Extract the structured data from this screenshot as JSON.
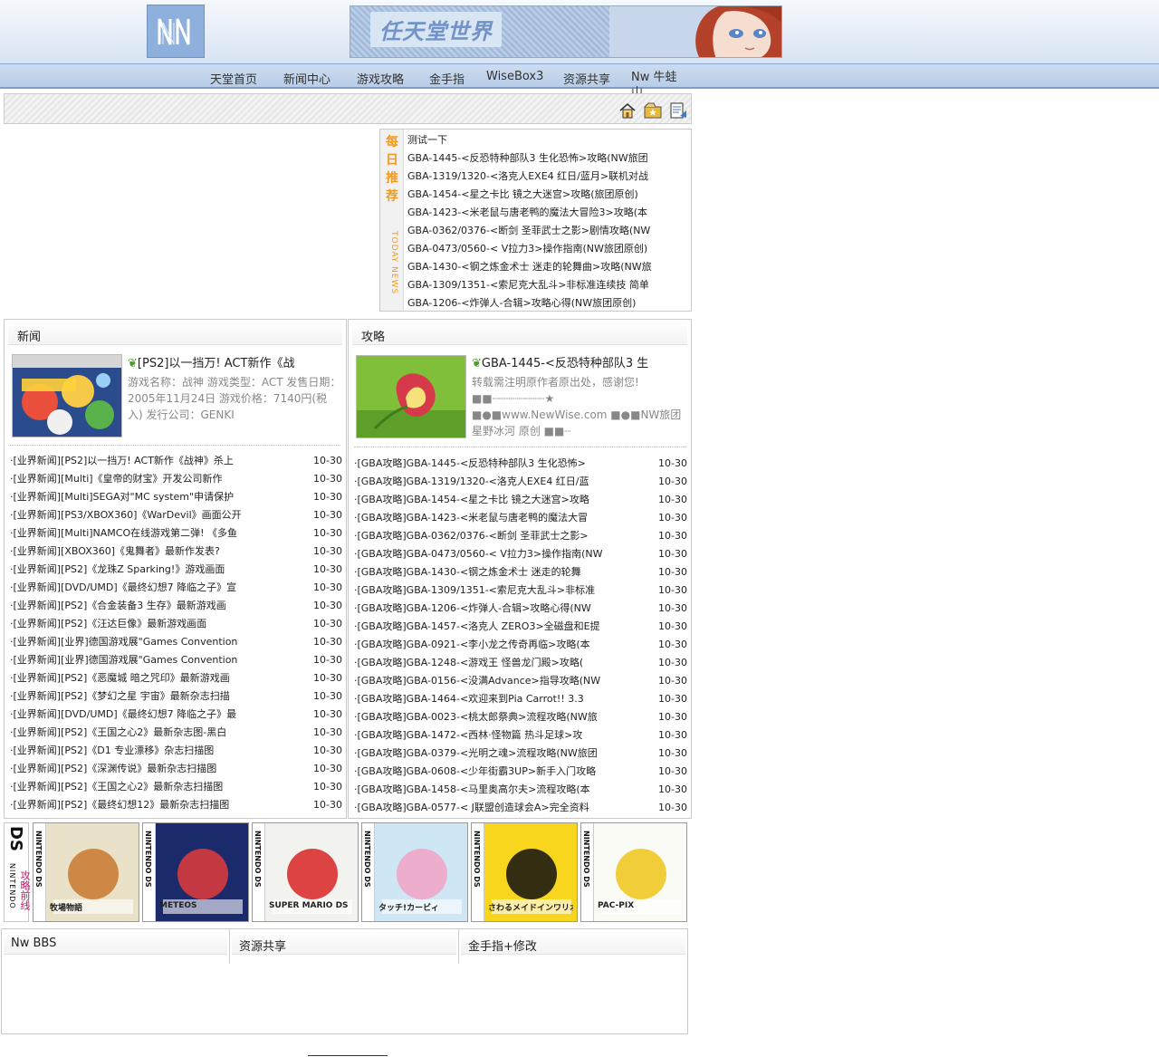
{
  "header": {
    "logo_text": "NN",
    "banner_title": "任天堂世界"
  },
  "nav": {
    "items": [
      "天堂首页",
      "新闻中心",
      "游戏攻略",
      "金手指",
      "WiseBox3",
      "资源共享",
      "Nw 牛蛙山"
    ]
  },
  "toolbar": {
    "icons": [
      "home-icon",
      "favorite-icon",
      "contact-icon"
    ]
  },
  "daily": {
    "title_cn": "每日推荐",
    "title_en": "TODAY NEWS",
    "items": [
      "测试一下",
      "GBA-1445-<反恐特种部队3 生化恐怖>攻略(NW旅团",
      "GBA-1319/1320-<洛克人EXE4 红日/蓝月>联机对战",
      "GBA-1454-<星之卡比 镜之大迷宫>攻略(旅团原创)",
      "GBA-1423-<米老鼠与唐老鸭的魔法大冒险3>攻略(本",
      "GBA-0362/0376-<断剑 圣菲武士之影>剧情攻略(NW",
      "GBA-0473/0560-< V拉力3>操作指南(NW旅团原创)",
      "GBA-1430-<钢之炼金术士 迷走的轮舞曲>攻略(NW旅",
      "GBA-1309/1351-<索尼克大乱斗>非标准连续技 简单",
      "GBA-1206-<炸弹人-合辑>攻略心得(NW旅团原创)"
    ]
  },
  "news": {
    "heading": "新闻",
    "feature": {
      "title": "[PS2]以一挡万! ACT新作《战",
      "body": "游戏名称：战神 游戏类型：ACT 发售日期：2005年11月24日 游戏价格：7140円(税入) 发行公司：GENKI"
    },
    "items": [
      {
        "t": "·[业界新闻][PS2]以一挡万! ACT新作《战神》杀上",
        "d": "10-30"
      },
      {
        "t": "·[业界新闻][Multi]《皇帝的财宝》开发公司新作",
        "d": "10-30"
      },
      {
        "t": "·[业界新闻][Multi]SEGA对\"MC system\"申请保护",
        "d": "10-30"
      },
      {
        "t": "·[业界新闻][PS3/XBOX360]《WarDevil》画面公开",
        "d": "10-30"
      },
      {
        "t": "·[业界新闻][Multi]NAMCO在线游戏第二弹! 《多鱼",
        "d": "10-30"
      },
      {
        "t": "·[业界新闻][XBOX360]《鬼舞者》最新作发表?",
        "d": "10-30"
      },
      {
        "t": "·[业界新闻][PS2]《龙珠Z Sparking!》游戏画面",
        "d": "10-30"
      },
      {
        "t": "·[业界新闻][DVD/UMD]《最终幻想7 降临之子》宣",
        "d": "10-30"
      },
      {
        "t": "·[业界新闻][PS2]《合金装备3 生存》最新游戏画",
        "d": "10-30"
      },
      {
        "t": "·[业界新闻][PS2]《汪达巨像》最新游戏画面",
        "d": "10-30"
      },
      {
        "t": "·[业界新闻][业界]德国游戏展\"Games Convention",
        "d": "10-30"
      },
      {
        "t": "·[业界新闻][业界]德国游戏展\"Games Convention",
        "d": "10-30"
      },
      {
        "t": "·[业界新闻][PS2]《恶魔城 暗之咒印》最新游戏画",
        "d": "10-30"
      },
      {
        "t": "·[业界新闻][PS2]《梦幻之星 宇宙》最新杂志扫描",
        "d": "10-30"
      },
      {
        "t": "·[业界新闻][DVD/UMD]《最终幻想7 降临之子》最",
        "d": "10-30"
      },
      {
        "t": "·[业界新闻][PS2]《王国之心2》最新杂志图-黑白",
        "d": "10-30"
      },
      {
        "t": "·[业界新闻][PS2]《D1 专业漂移》杂志扫描图",
        "d": "10-30"
      },
      {
        "t": "·[业界新闻][PS2]《深渊传说》最新杂志扫描图",
        "d": "10-30"
      },
      {
        "t": "·[业界新闻][PS2]《王国之心2》最新杂志扫描图",
        "d": "10-30"
      },
      {
        "t": "·[业界新闻][PS2]《最终幻想12》最新杂志扫描图",
        "d": "10-30"
      }
    ]
  },
  "guide": {
    "heading": "攻略",
    "feature": {
      "title": "GBA-1445-<反恐特种部队3 生",
      "body": "转载需注明原作者原出处，感谢您! ■■┈┈┈┈┈┈┈┈★ ■●■www.NewWise.com ■●■NW旅团 星野冰河 原创 ■■┈"
    },
    "items": [
      {
        "t": "·[GBA攻略]GBA-1445-<反恐特种部队3 生化恐怖>",
        "d": "10-30"
      },
      {
        "t": "·[GBA攻略]GBA-1319/1320-<洛克人EXE4 红日/蓝",
        "d": "10-30"
      },
      {
        "t": "·[GBA攻略]GBA-1454-<星之卡比 镜之大迷宫>攻略",
        "d": "10-30"
      },
      {
        "t": "·[GBA攻略]GBA-1423-<米老鼠与唐老鸭的魔法大冒",
        "d": "10-30"
      },
      {
        "t": "·[GBA攻略]GBA-0362/0376-<断剑 圣菲武士之影>",
        "d": "10-30"
      },
      {
        "t": "·[GBA攻略]GBA-0473/0560-< V拉力3>操作指南(NW",
        "d": "10-30"
      },
      {
        "t": "·[GBA攻略]GBA-1430-<钢之炼金术士 迷走的轮舞",
        "d": "10-30"
      },
      {
        "t": "·[GBA攻略]GBA-1309/1351-<索尼克大乱斗>非标准",
        "d": "10-30"
      },
      {
        "t": "·[GBA攻略]GBA-1206-<炸弹人-合辑>攻略心得(NW",
        "d": "10-30"
      },
      {
        "t": "·[GBA攻略]GBA-1457-<洛克人 ZERO3>全磁盘和E提",
        "d": "10-30"
      },
      {
        "t": "·[GBA攻略]GBA-0921-<李小龙之传奇再临>攻略(本",
        "d": "10-30"
      },
      {
        "t": "·[GBA攻略]GBA-1248-<游戏王 怪兽龙门殿>攻略(",
        "d": "10-30"
      },
      {
        "t": "·[GBA攻略]GBA-0156-<没满Advance>指导攻略(NW",
        "d": "10-30"
      },
      {
        "t": "·[GBA攻略]GBA-1464-<欢迎来到Pia Carrot!! 3.3",
        "d": "10-30"
      },
      {
        "t": "·[GBA攻略]GBA-0023-<桃太郎祭典>流程攻略(NW旅",
        "d": "10-30"
      },
      {
        "t": "·[GBA攻略]GBA-1472-<西林·怪物篇 热斗足球>攻",
        "d": "10-30"
      },
      {
        "t": "·[GBA攻略]GBA-0379-<光明之魂>流程攻略(NW旅团",
        "d": "10-30"
      },
      {
        "t": "·[GBA攻略]GBA-0608-<少年街霸3UP>新手入门攻略",
        "d": "10-30"
      },
      {
        "t": "·[GBA攻略]GBA-1458-<马里奥高尔夫>流程攻略(本",
        "d": "10-30"
      },
      {
        "t": "·[GBA攻略]GBA-0577-< J联盟创造球会A>完全资料",
        "d": "10-30"
      }
    ]
  },
  "ds_strip": {
    "logo": "DS",
    "brand": "NINTENDO",
    "promo": "攻略前线",
    "spine_label": "NINTENDO DS",
    "covers": [
      {
        "name": "harvest-moon-cover",
        "bg": "#e9e2c8",
        "accent": "#c9782e",
        "title": "牧場物語"
      },
      {
        "name": "meteos-cover",
        "bg": "#1b2a6b",
        "accent": "#e23b3b",
        "title": "METEOS"
      },
      {
        "name": "super-mario-ds-cover",
        "bg": "#f2f2ee",
        "accent": "#d92525",
        "title": "SUPER MARIO DS"
      },
      {
        "name": "kirby-cover",
        "bg": "#cfe6f4",
        "accent": "#f2a3c6",
        "title": "タッチ!カービィ"
      },
      {
        "name": "warioware-touched-cover",
        "bg": "#f8d61e",
        "accent": "#111111",
        "title": "さわるメイドインワリオ"
      },
      {
        "name": "pac-pix-cover",
        "bg": "#fbfbf5",
        "accent": "#f0c419",
        "title": "PAC-PIX"
      }
    ]
  },
  "bottom": {
    "columns": [
      "Nw BBS",
      "资源共享",
      "金手指+修改"
    ]
  },
  "colors": {
    "accent_orange": "#f39a1c",
    "promo_pink": "#c0146a",
    "nav_blue": "#b9cde7",
    "leaf_green": "#4a9a2a"
  }
}
